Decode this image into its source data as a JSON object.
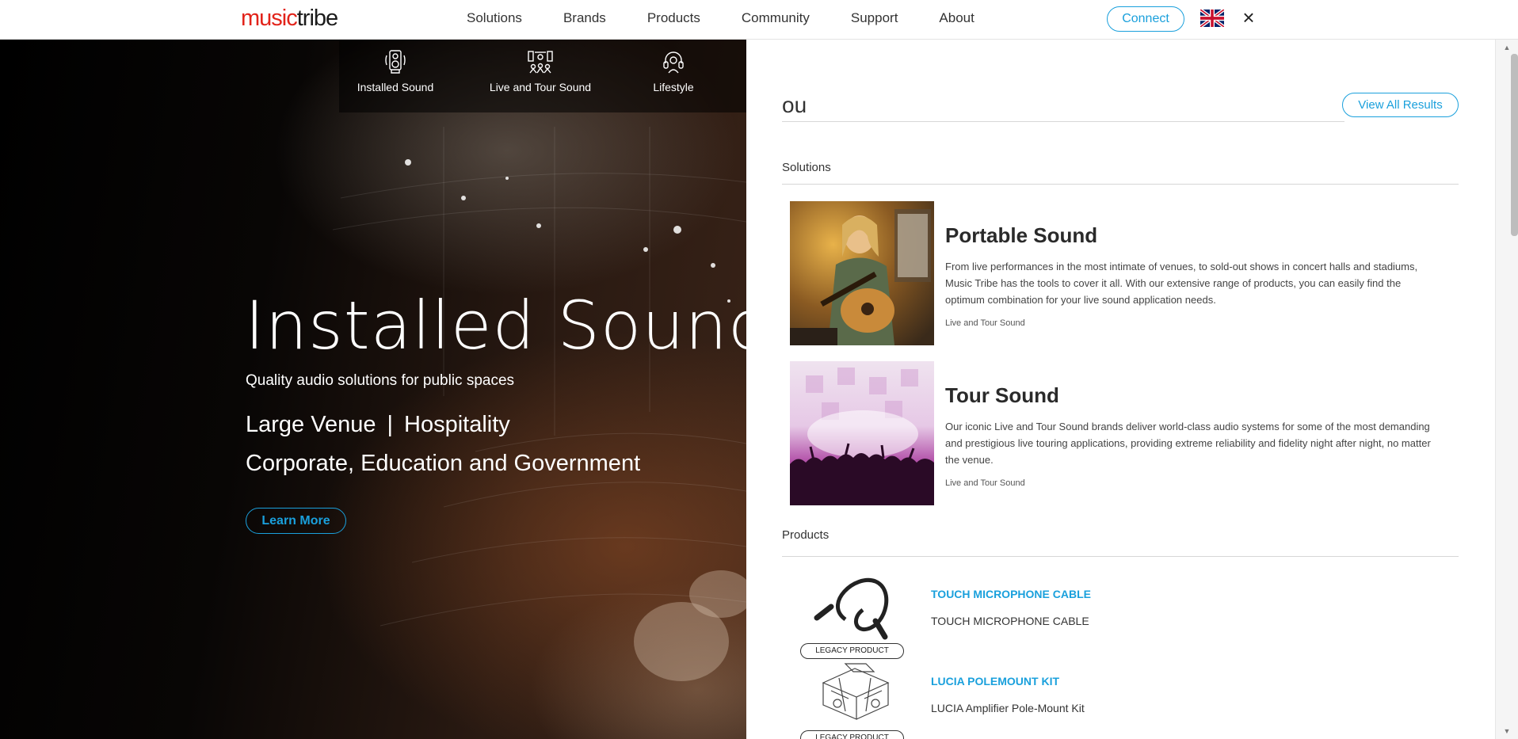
{
  "header": {
    "logo": {
      "part1": "music",
      "part2": "tribe"
    },
    "nav": [
      "Solutions",
      "Brands",
      "Products",
      "Community",
      "Support",
      "About"
    ],
    "connect_label": "Connect",
    "flag_icon": "uk-flag-icon",
    "close_glyph": "×"
  },
  "hero": {
    "tabs": [
      {
        "label": "Installed Sound",
        "icon": "speaker-icon"
      },
      {
        "label": "Live and Tour Sound",
        "icon": "stage-crowd-icon"
      },
      {
        "label": "Lifestyle",
        "icon": "headphones-icon"
      }
    ],
    "title": "Installed Sound",
    "subtitle": "Quality audio solutions for public spaces",
    "line1_a": "Large Venue",
    "line1_sep": "|",
    "line1_b": "Hospitality",
    "line2": "Corporate, Education and Government",
    "cta_label": "Learn More"
  },
  "search": {
    "query": "ou",
    "view_all_label": "View All Results",
    "solutions_heading": "Solutions",
    "solutions": [
      {
        "title": "Portable Sound",
        "description": "From live performances in the most intimate of venues, to sold-out shows in concert halls and stadiums, Music Tribe has the tools to cover it all. With our extensive range of products, you can easily find the optimum combination for your live sound application needs.",
        "tag": "Live and Tour Sound"
      },
      {
        "title": "Tour Sound",
        "description": "Our iconic Live and Tour Sound brands deliver world-class audio systems for some of the most demanding and prestigious live touring applications, providing extreme reliability and fidelity night after night, no matter the venue.",
        "tag": "Live and Tour Sound"
      }
    ],
    "products_heading": "Products",
    "products": [
      {
        "name": "TOUCH MICROPHONE CABLE",
        "description": "TOUCH MICROPHONE CABLE",
        "badge": "LEGACY PRODUCT"
      },
      {
        "name": "LUCIA POLEMOUNT KIT",
        "description": "LUCIA Amplifier Pole-Mount Kit",
        "badge": "LEGACY PRODUCT"
      }
    ]
  },
  "colors": {
    "accent": "#1aa0dc",
    "logo_red": "#e2231a"
  }
}
